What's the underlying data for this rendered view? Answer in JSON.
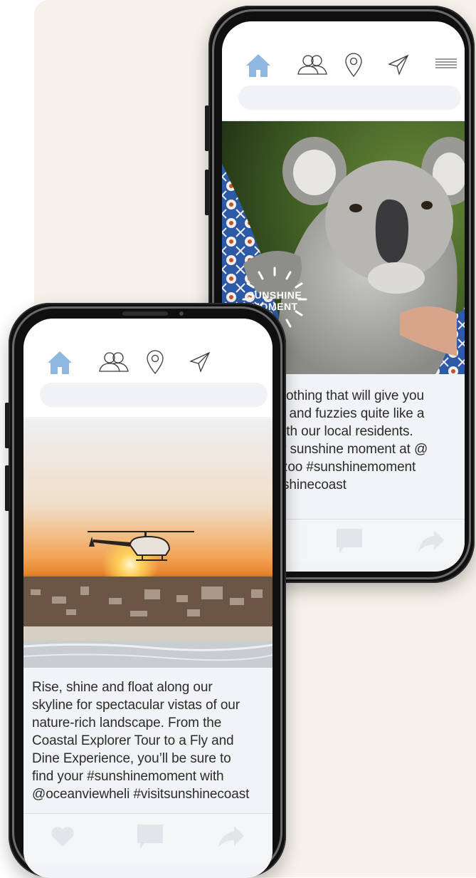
{
  "colors": {
    "background": "#f6f1ea",
    "home_icon": "#8fb8e0",
    "action_icons": "#e3e5ea",
    "phone_frame": "#0f0f0f"
  },
  "phones": [
    {
      "id": "back",
      "nav_icons": [
        "home-icon",
        "friends-icon",
        "location-pin-icon",
        "paper-plane-icon",
        "menu-icon"
      ],
      "search_placeholder": "",
      "photo": "koala-with-sunshine-moment-badge",
      "badge_lines": [
        "SUNSHINE",
        "MOMENT"
      ],
      "caption": "There’s nothing that will give you\nthe warm and fuzzies quite like a\ncuddle with our local residents.\nFind your sunshine moment at @\naustraliazoo #sunshinemoment\n#visitsunshinecoast",
      "actions": [
        "heart-icon",
        "comment-icon",
        "share-icon"
      ]
    },
    {
      "id": "front",
      "nav_icons": [
        "home-icon",
        "friends-icon",
        "location-pin-icon",
        "paper-plane-icon"
      ],
      "search_placeholder": "",
      "photo": "helicopter-over-coast-at-sunrise",
      "caption": "Rise, shine and float along our\nskyline for spectacular vistas of our\nnature-rich landscape. From the\nCoastal Explorer Tour to a Fly and\nDine Experience, you’ll be sure to\nfind your #sunshinemoment with\n@oceanviewheli #visitsunshinecoast",
      "actions": [
        "heart-icon",
        "comment-icon",
        "share-icon"
      ]
    }
  ]
}
